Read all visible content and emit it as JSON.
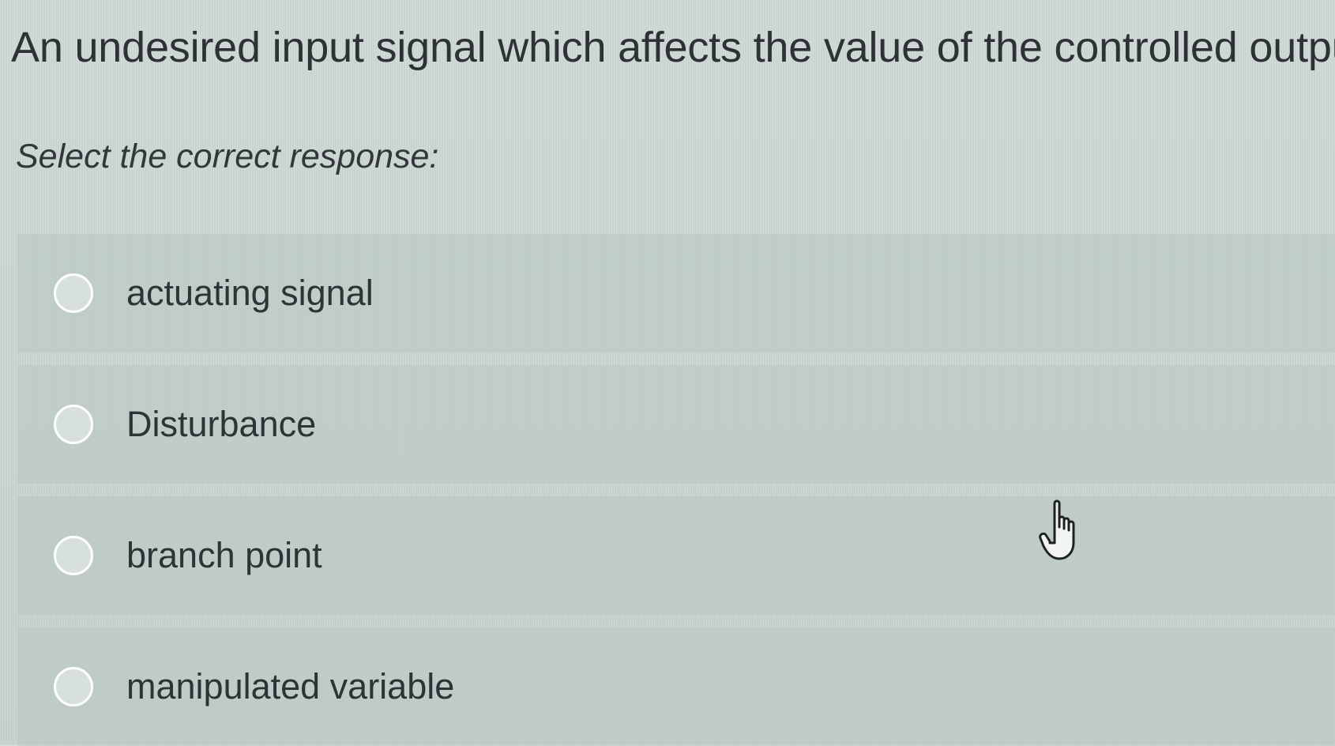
{
  "question": {
    "text": "An undesired input signal which affects the value of the controlled output"
  },
  "instruction": "Select the correct response:",
  "options": [
    {
      "label": "actuating signal",
      "selected": false
    },
    {
      "label": "Disturbance",
      "selected": false
    },
    {
      "label": "branch point",
      "selected": false
    },
    {
      "label": "manipulated variable",
      "selected": false
    }
  ],
  "cursor": {
    "icon": "hand-pointer-icon"
  }
}
